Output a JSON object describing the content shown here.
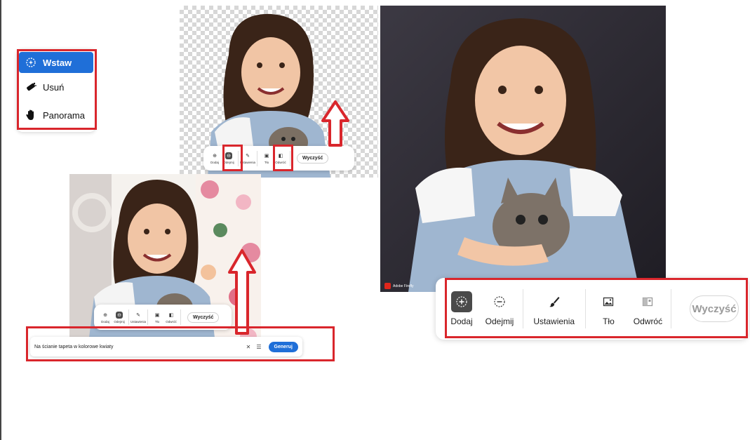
{
  "mode_menu": {
    "items": [
      {
        "label": "Wstaw",
        "icon": "sparkle-circle-icon",
        "active": true
      },
      {
        "label": "Usuń",
        "icon": "eraser-icon",
        "active": false
      },
      {
        "label": "Panorama",
        "icon": "hand-icon",
        "active": false
      }
    ]
  },
  "mini_toolbar_top": {
    "tools": [
      "Dodaj",
      "Odejmij",
      "Ustawienia",
      "Tło",
      "Odwróć"
    ],
    "clear_label": "Wyczyść"
  },
  "mini_toolbar_bottom": {
    "tools": [
      "Dodaj",
      "Odejmij",
      "Ustawienia",
      "Tło",
      "Odwróć"
    ],
    "clear_label": "Wyczyść"
  },
  "main_toolbar": {
    "add_label": "Dodaj",
    "subtract_label": "Odejmij",
    "settings_label": "Ustawienia",
    "background_label": "Tło",
    "invert_label": "Odwróć",
    "clear_label": "Wyczyść"
  },
  "prompt_bar": {
    "text": "Na ścianie tapeta w kolorowe kwiaty",
    "generate_label": "Generuj"
  },
  "watermark": "Adobe Firefly",
  "colors": {
    "accent": "#1f6fd8",
    "highlight": "#d9262c",
    "dark_backdrop": "#2d2b33"
  }
}
